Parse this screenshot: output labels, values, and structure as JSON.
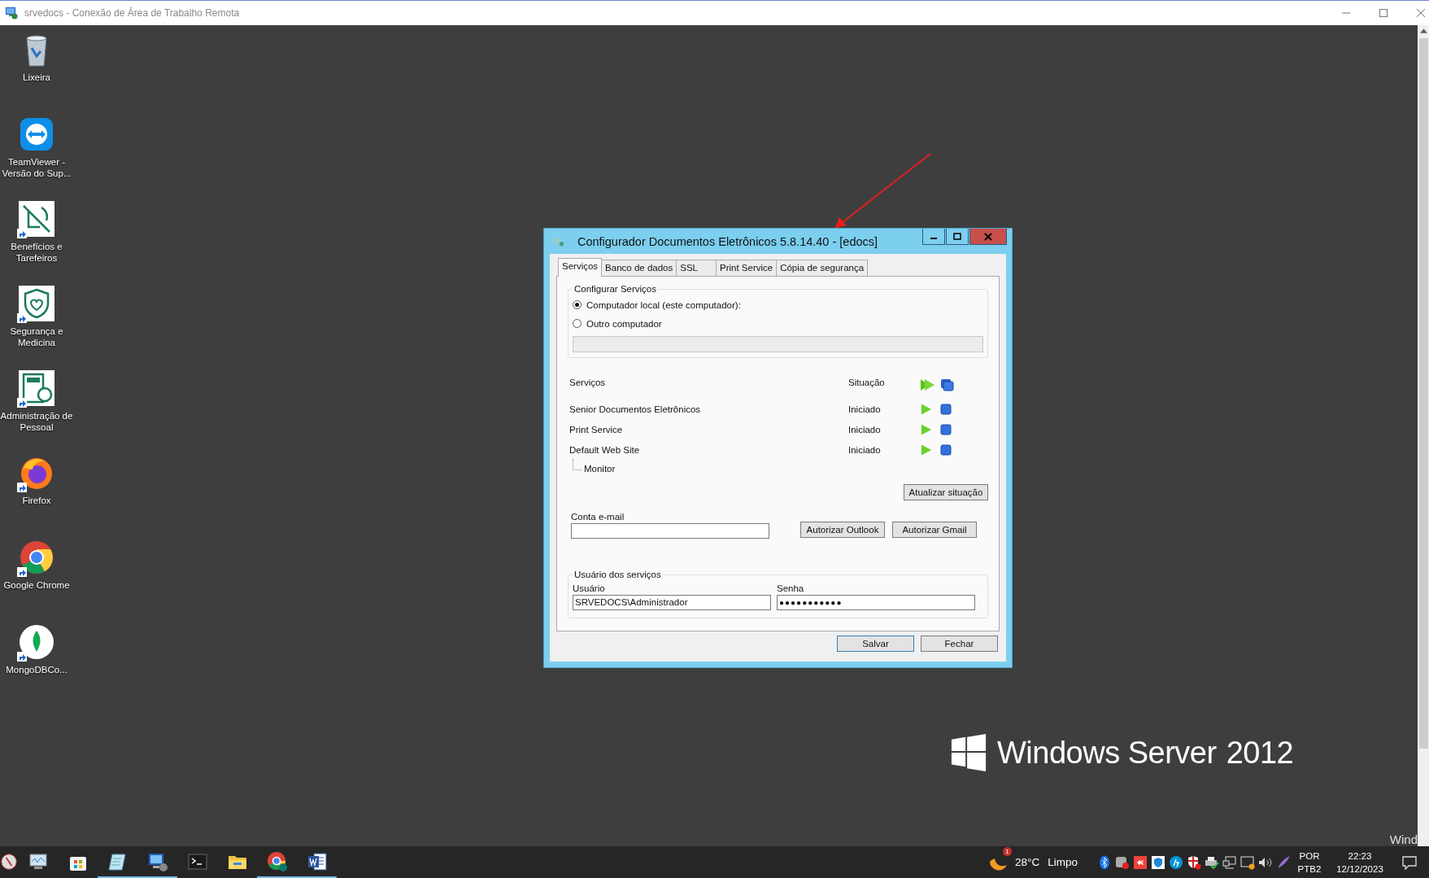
{
  "rdp_window": {
    "title": "srvedocs - Conexão de Área de Trabalho Remota"
  },
  "desktop_icons": [
    {
      "label": "Lixeira",
      "kind": "recycle-bin",
      "shortcut": false
    },
    {
      "label": "TeamViewer - Versão do Sup...",
      "kind": "teamviewer",
      "shortcut": false
    },
    {
      "label": "Benefícios e Tarefeiros",
      "kind": "benefits",
      "shortcut": true
    },
    {
      "label": "Segurança e Medicina",
      "kind": "health",
      "shortcut": true
    },
    {
      "label": "Administração de Pessoal",
      "kind": "payroll",
      "shortcut": true
    },
    {
      "label": "Firefox",
      "kind": "firefox",
      "shortcut": true
    },
    {
      "label": "Google Chrome",
      "kind": "chrome",
      "shortcut": true
    },
    {
      "label": "MongoDBCo...",
      "kind": "mongodb",
      "shortcut": true
    }
  ],
  "wallpaper": {
    "brand": "Windows Server",
    "version": "2012",
    "overlay_text": "Wind"
  },
  "dialog": {
    "title": "Configurador Documentos Eletrônicos 5.8.14.40 - [edocs]",
    "tabs": [
      {
        "label": "Serviços",
        "selected": true
      },
      {
        "label": "Banco de dados",
        "selected": false
      },
      {
        "label": "SSL",
        "selected": false
      },
      {
        "label": "Print Service",
        "selected": false
      },
      {
        "label": "Cópia de segurança",
        "selected": false
      }
    ],
    "configure_group": {
      "legend": "Configurar Serviços",
      "options": [
        {
          "label": "Computador local (este computador):",
          "selected": true
        },
        {
          "label": "Outro computador",
          "selected": false
        }
      ],
      "host_field": {
        "disabled": true
      }
    },
    "services": {
      "name_header": "Serviços",
      "status_header": "Situação",
      "rows": [
        {
          "name": "Senior Documentos Eletrônicos",
          "status": "Iniciado",
          "children": []
        },
        {
          "name": "Print Service",
          "status": "Iniciado",
          "children": []
        },
        {
          "name": "Default Web Site",
          "status": "Iniciado",
          "children": [
            {
              "name": "Monitor"
            }
          ]
        }
      ]
    },
    "refresh_button": "Atualizar situação",
    "email": {
      "label": "Conta e-mail",
      "buttons": [
        "Autorizar Outlook",
        "Autorizar Gmail"
      ]
    },
    "user_group": {
      "legend": "Usuário dos serviços",
      "user_label": "Usuário",
      "user_value": "SRVEDOCS\\Administrador",
      "password_label": "Senha",
      "password_value": "●●●●●●●●●●●"
    },
    "footer_buttons": [
      {
        "label": "Salvar",
        "default": true
      },
      {
        "label": "Fechar",
        "default": false
      }
    ]
  },
  "taskbar": {
    "apps": [
      {
        "kind": "power",
        "running": false
      },
      {
        "kind": "monitor",
        "running": false
      },
      {
        "kind": "store",
        "running": false
      },
      {
        "kind": "notepad",
        "running": true
      },
      {
        "kind": "remote-desktop",
        "running": true
      },
      {
        "kind": "terminal",
        "running": false
      },
      {
        "kind": "folder",
        "running": false
      },
      {
        "kind": "chrome",
        "running": true
      },
      {
        "kind": "word",
        "running": true
      }
    ],
    "weather": {
      "badge": "1",
      "temperature": "28°C",
      "condition": "Limpo"
    },
    "tray_icons": [
      {
        "kind": "bluetooth"
      },
      {
        "kind": "sync-error"
      },
      {
        "kind": "remote-red"
      },
      {
        "kind": "shield-app"
      },
      {
        "kind": "hp"
      },
      {
        "kind": "shield-error"
      },
      {
        "kind": "printer-ok"
      },
      {
        "kind": "network"
      },
      {
        "kind": "display-alert"
      },
      {
        "kind": "volume"
      },
      {
        "kind": "pen"
      }
    ],
    "language": {
      "code": "POR",
      "layout": "PTB2"
    },
    "clock": {
      "time": "22:23",
      "date": "12/12/2023"
    }
  }
}
